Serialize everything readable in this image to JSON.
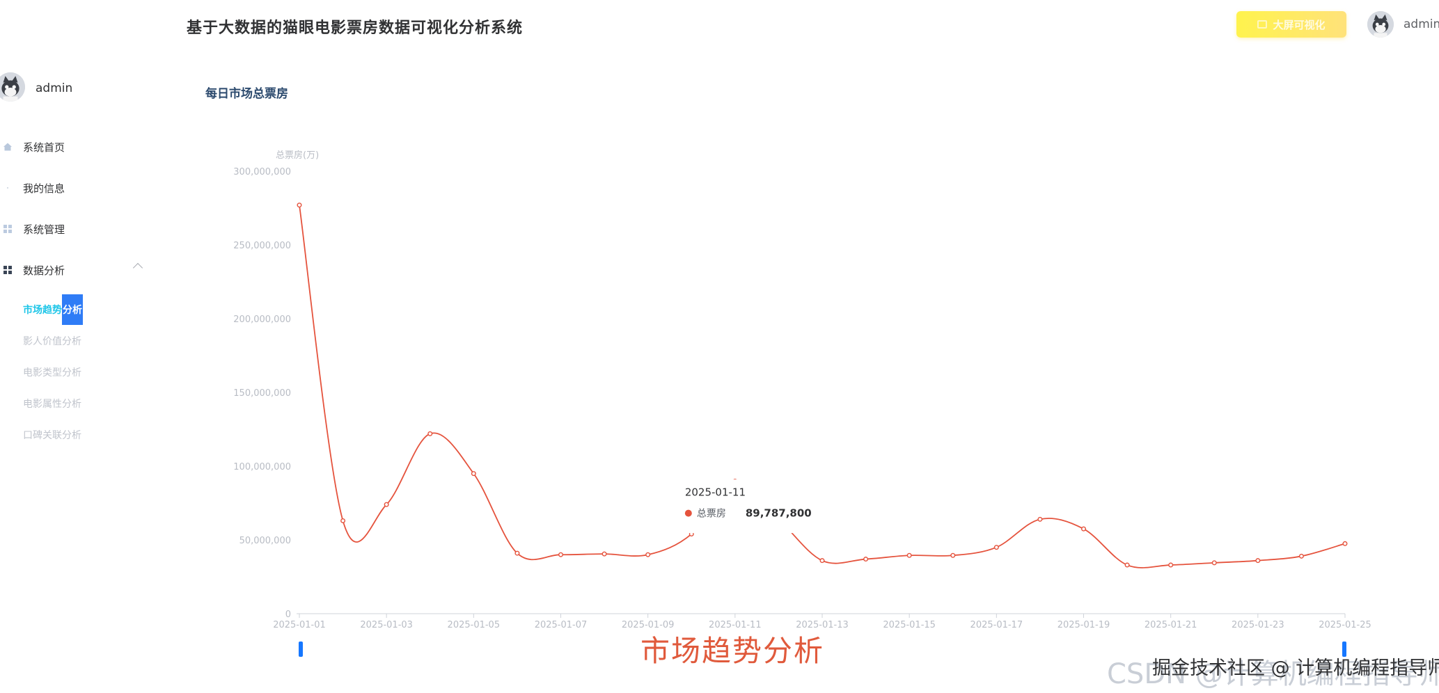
{
  "app": {
    "title": "基于大数据的猫眼电影票房数据可视化分析系统"
  },
  "header": {
    "bigscreen_label": "大屏可视化",
    "user": "admin"
  },
  "sidebar": {
    "user": "admin",
    "menu": [
      {
        "label": "系统首页",
        "icon": "home-icon"
      },
      {
        "label": "我的信息",
        "icon": "user-icon"
      },
      {
        "label": "系统管理",
        "icon": "grid-icon"
      },
      {
        "label": "数据分析",
        "icon": "grid-icon",
        "expanded": true
      }
    ],
    "sub_menu": [
      {
        "label_part1": "市场趋势",
        "label_part2": "分析",
        "active": true
      },
      {
        "label": "影人价值分析"
      },
      {
        "label": "电影类型分析"
      },
      {
        "label": "电影属性分析"
      },
      {
        "label": "口碑关联分析"
      }
    ]
  },
  "main": {
    "section_title": "每日市场总票房"
  },
  "chart_data": {
    "type": "line",
    "ylabel": "总票房(万)",
    "ylim": [
      0,
      300000000
    ],
    "y_ticks": [
      "0",
      "50,000,000",
      "100,000,000",
      "150,000,000",
      "200,000,000",
      "250,000,000",
      "300,000,000"
    ],
    "x_tick_labels": [
      "2025-01-01",
      "2025-01-03",
      "2025-01-05",
      "2025-01-07",
      "2025-01-09",
      "2025-01-11",
      "2025-01-13",
      "2025-01-15",
      "2025-01-17",
      "2025-01-19",
      "2025-01-21",
      "2025-01-23",
      "2025-01-25"
    ],
    "x": [
      "2025-01-01",
      "2025-01-02",
      "2025-01-03",
      "2025-01-04",
      "2025-01-05",
      "2025-01-06",
      "2025-01-07",
      "2025-01-08",
      "2025-01-09",
      "2025-01-10",
      "2025-01-11",
      "2025-01-12",
      "2025-01-13",
      "2025-01-14",
      "2025-01-15",
      "2025-01-16",
      "2025-01-17",
      "2025-01-18",
      "2025-01-19",
      "2025-01-20",
      "2025-01-21",
      "2025-01-22",
      "2025-01-23",
      "2025-01-24",
      "2025-01-25"
    ],
    "series": [
      {
        "name": "总票房",
        "color": "#e5533d",
        "values": [
          277000000,
          63000000,
          74000000,
          122000000,
          95000000,
          41000000,
          40000000,
          40500000,
          40000000,
          54000000,
          89787800,
          64000000,
          36000000,
          37000000,
          39500000,
          39500000,
          45000000,
          64000000,
          57500000,
          33000000,
          33000000,
          34500000,
          36000000,
          39000000,
          47500000
        ]
      }
    ],
    "tooltip": {
      "date": "2025-01-11",
      "series": "总票房",
      "value": "89,787,800"
    },
    "grid": false
  },
  "overlay": {
    "caption": "市场趋势分析",
    "watermark_back": "CSDN @计算机编程指导师",
    "watermark_front": "掘金技术社区 @ 计算机编程指导师"
  }
}
